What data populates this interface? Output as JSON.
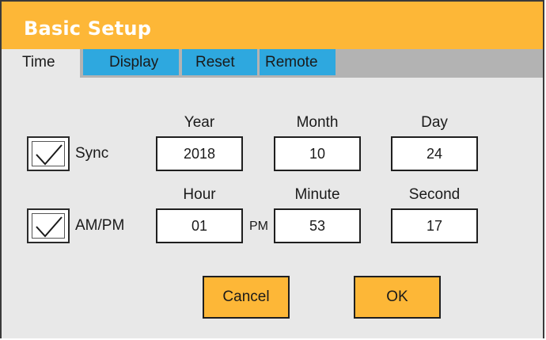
{
  "window": {
    "title": "Basic Setup"
  },
  "tabs": [
    {
      "label": "Time",
      "active": true
    },
    {
      "label": "Display",
      "active": false
    },
    {
      "label": "Reset",
      "active": false
    },
    {
      "label": "Remote",
      "active": false
    }
  ],
  "date": {
    "sync_label": "Sync",
    "sync_checked": true,
    "headers": {
      "year": "Year",
      "month": "Month",
      "day": "Day"
    },
    "values": {
      "year": "2018",
      "month": "10",
      "day": "24"
    }
  },
  "time": {
    "ampm_label": "AM/PM",
    "ampm_checked": true,
    "headers": {
      "hour": "Hour",
      "minute": "Minute",
      "second": "Second"
    },
    "values": {
      "hour": "01",
      "minute": "53",
      "second": "17"
    },
    "meridiem": "PM"
  },
  "buttons": {
    "cancel": "Cancel",
    "ok": "OK"
  },
  "colors": {
    "accent": "#fdb737",
    "tab_inactive": "#2ea8df",
    "tab_bar": "#b3b3b3",
    "panel": "#e8e8e8"
  }
}
